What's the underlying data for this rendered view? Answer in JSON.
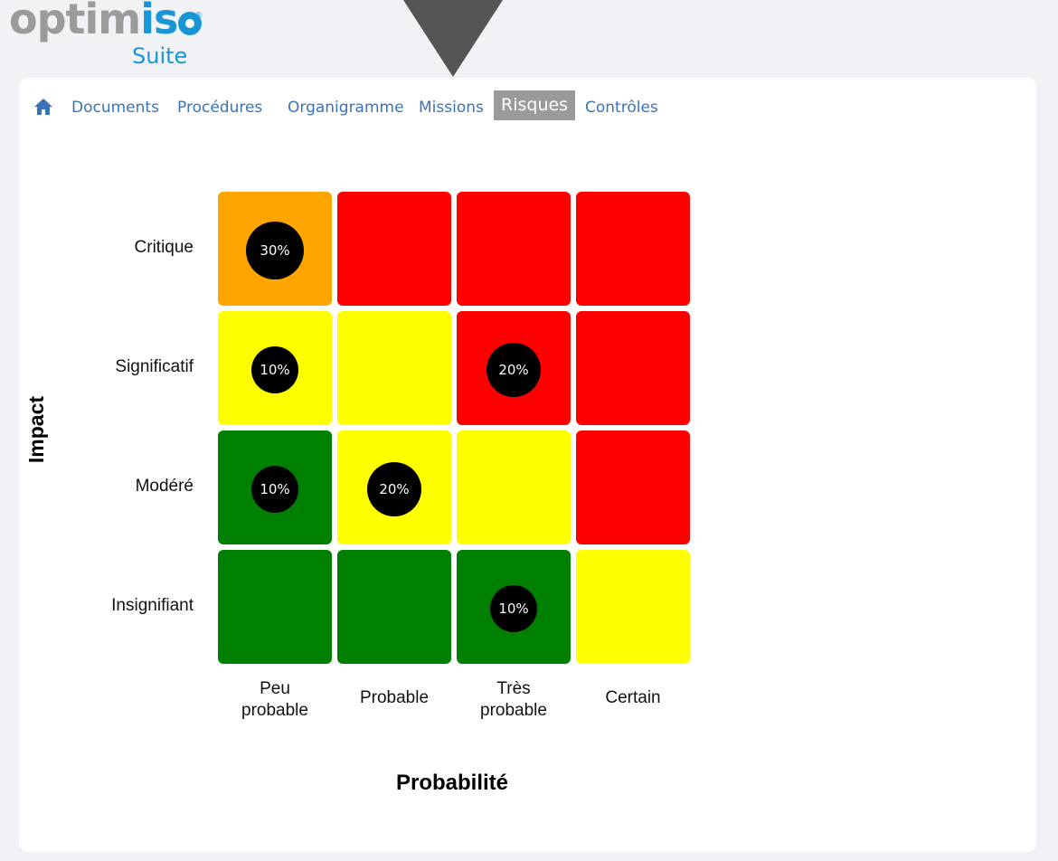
{
  "brand": {
    "name_part1": "optim",
    "name_part2": "is",
    "registered": "®",
    "suite": "Suite"
  },
  "nav": {
    "items": [
      {
        "label": "Documents",
        "active": false
      },
      {
        "label": "Procédures",
        "active": false
      },
      {
        "label": "Organigramme",
        "active": false
      },
      {
        "label": "Missions",
        "active": false
      },
      {
        "label": "Risques",
        "active": true
      },
      {
        "label": "Contrôles",
        "active": false
      }
    ]
  },
  "matrix": {
    "y_axis_title": "Impact",
    "x_axis_title": "Probabilité",
    "rows": [
      "Critique",
      "Significatif",
      "Modéré",
      "Insignifiant"
    ],
    "columns": [
      "Peu\nprobable",
      "Probable",
      "Très\nprobable",
      "Certain"
    ],
    "colors": {
      "orange": "#ffa500",
      "red": "#ff0000",
      "yellow": "#ffff00",
      "green": "#008000",
      "bubble": "#000000"
    },
    "cells": [
      [
        {
          "color": "orange",
          "value": "30%"
        },
        {
          "color": "red",
          "value": ""
        },
        {
          "color": "red",
          "value": ""
        },
        {
          "color": "red",
          "value": ""
        }
      ],
      [
        {
          "color": "yellow",
          "value": "10%"
        },
        {
          "color": "yellow",
          "value": ""
        },
        {
          "color": "red",
          "value": "20%"
        },
        {
          "color": "red",
          "value": ""
        }
      ],
      [
        {
          "color": "green",
          "value": "10%"
        },
        {
          "color": "yellow",
          "value": "20%"
        },
        {
          "color": "yellow",
          "value": ""
        },
        {
          "color": "red",
          "value": ""
        }
      ],
      [
        {
          "color": "green",
          "value": ""
        },
        {
          "color": "green",
          "value": ""
        },
        {
          "color": "green",
          "value": "10%"
        },
        {
          "color": "yellow",
          "value": ""
        }
      ]
    ]
  }
}
